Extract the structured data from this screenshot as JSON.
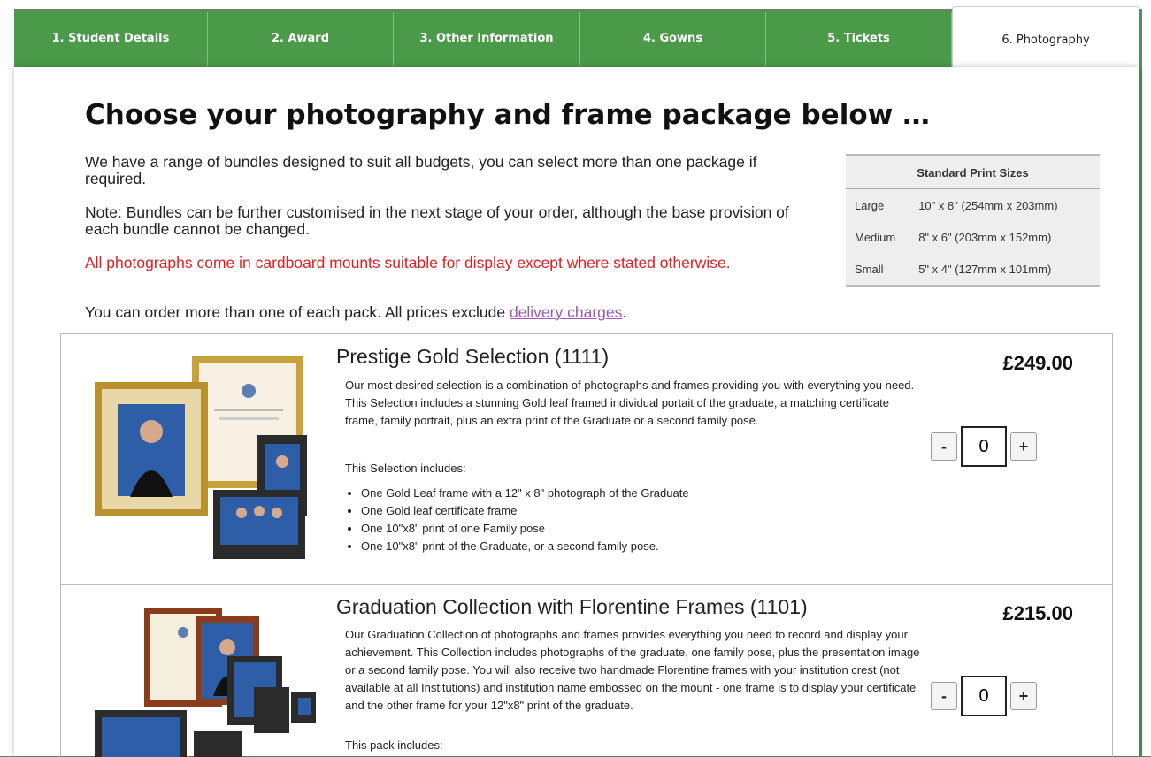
{
  "tabs": [
    {
      "label": "1. Student Details"
    },
    {
      "label": "2. Award"
    },
    {
      "label": "3. Other Information"
    },
    {
      "label": "4. Gowns"
    },
    {
      "label": "5. Tickets"
    },
    {
      "label": "6. Photography"
    }
  ],
  "page": {
    "title": "Choose your photography and frame package below …",
    "intro1": "We have a range of bundles designed to suit all budgets, you can select more than one package if required.",
    "intro2": "Note: Bundles can be further customised in the next stage of your order, although the base provision of each bundle cannot be changed.",
    "intro3": "All photographs come in cardboard mounts suitable for display except where stated otherwise.",
    "intro4_text": "You can order more than one of each pack. All prices exclude ",
    "intro4_link": "delivery charges",
    "intro4_end": "."
  },
  "sizes": {
    "header": "Standard Print Sizes",
    "rows": [
      {
        "name": "Large",
        "value": "10\" x 8\" (254mm x 203mm)"
      },
      {
        "name": "Medium",
        "value": "8\" x 6\" (203mm x 152mm)"
      },
      {
        "name": "Small",
        "value": "5\" x 4\" (127mm x 101mm)"
      }
    ]
  },
  "products": [
    {
      "title": "Prestige Gold Selection (1111)",
      "price": "£249.00",
      "qty": "0",
      "desc": "Our most desired selection is a combination of photographs and frames providing you with everything you need. This Selection includes a stunning Gold leaf framed individual portait of the graduate, a matching certificate frame, family portrait, plus an extra print of the Graduate or a second family pose.",
      "includes_label": "This Selection includes:",
      "items": [
        "One Gold Leaf frame with a 12\" x 8\" photograph of the Graduate",
        "One Gold leaf certificate frame",
        "One 10\"x8\" print of one Family pose",
        "One 10\"x8\" print of the Graduate, or a second family pose."
      ]
    },
    {
      "title": "Graduation Collection with Florentine Frames (1101)",
      "price": "£215.00",
      "qty": "0",
      "desc": "Our Graduation Collection of photographs and frames provides everything you need to record and display your achievement.   This Collection includes photographs of the graduate, one family pose, plus the presentation image or a second family pose. You will also receive two handmade Florentine frames with your institution crest (not available at all Institutions) and institution name embossed on the mount - one frame is to display your certificate and the other frame for your 12\"x8\" print of the graduate.",
      "includes_label": "This pack includes:"
    }
  ],
  "qty_minus": "-",
  "qty_plus": "+"
}
